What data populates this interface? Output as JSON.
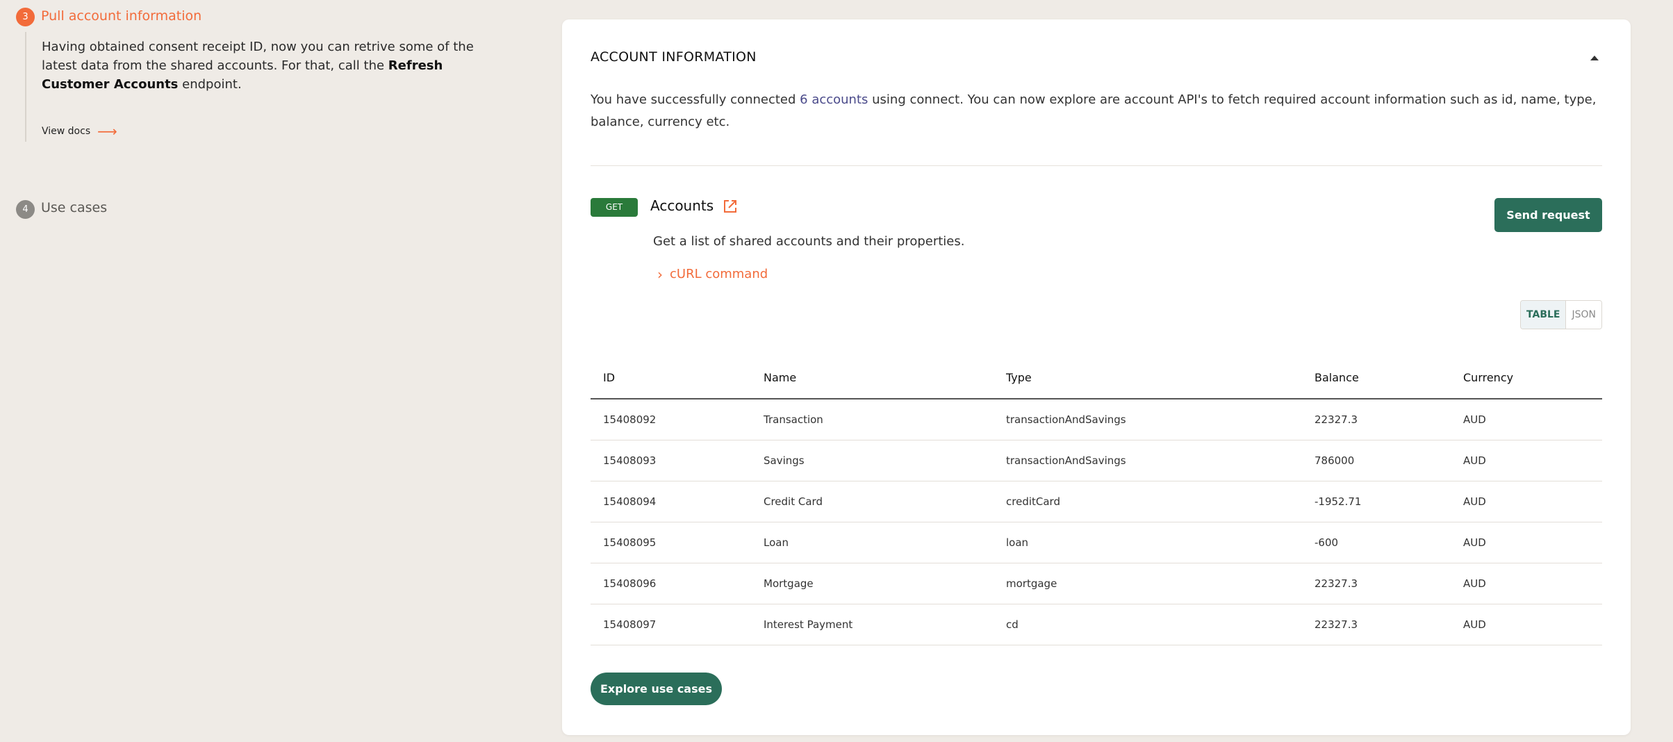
{
  "steps": {
    "step3": {
      "number": "3",
      "title": "Pull account information",
      "desc_part1": "Having obtained consent receipt ID, now you can retrive some of the latest data from the shared accounts. For that, call the ",
      "desc_bold": "Refresh Customer Accounts",
      "desc_part2": " endpoint.",
      "view_docs": "View docs"
    },
    "step4": {
      "number": "4",
      "title": "Use cases"
    }
  },
  "card": {
    "title": "ACCOUNT INFORMATION",
    "intro_part1": "You have successfully connected ",
    "intro_link": "6 accounts",
    "intro_part2": " using connect. You can now explore are account API's to fetch required account information such as id, name, type, balance, currency etc.",
    "endpoint": {
      "method": "GET",
      "title": "Accounts",
      "description": "Get a list of shared accounts and their properties.",
      "curl_label": "cURL command",
      "send_label": "Send request"
    },
    "view_toggle": {
      "table": "TABLE",
      "json": "JSON",
      "active": "TABLE"
    },
    "table": {
      "columns": [
        "ID",
        "Name",
        "Type",
        "Balance",
        "Currency"
      ],
      "rows": [
        [
          "15408092",
          "Transaction",
          "transactionAndSavings",
          "22327.3",
          "AUD"
        ],
        [
          "15408093",
          "Savings",
          "transactionAndSavings",
          "786000",
          "AUD"
        ],
        [
          "15408094",
          "Credit Card",
          "creditCard",
          "-1952.71",
          "AUD"
        ],
        [
          "15408095",
          "Loan",
          "loan",
          "-600",
          "AUD"
        ],
        [
          "15408096",
          "Mortgage",
          "mortgage",
          "22327.3",
          "AUD"
        ],
        [
          "15408097",
          "Interest Payment",
          "cd",
          "22327.3",
          "AUD"
        ]
      ]
    },
    "explore_label": "Explore use cases"
  },
  "colors": {
    "accent": "#f26b3a",
    "primary": "#2b6e5a",
    "get_badge": "#2a7a3a",
    "background": "#efebe6"
  },
  "icons": {
    "view_docs": "arrow-right-icon",
    "external_link": "external-link-icon",
    "curl_toggle": "chevron-right-icon",
    "collapse": "caret-up-icon"
  }
}
